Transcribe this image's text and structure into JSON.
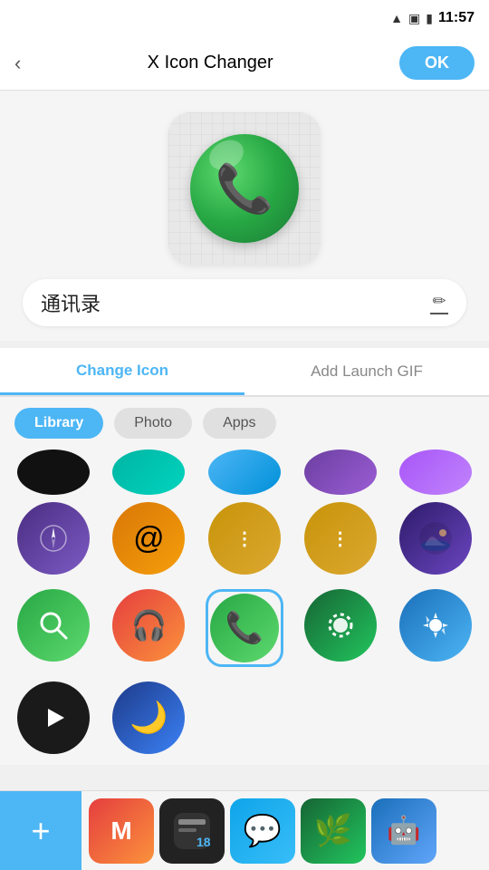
{
  "statusBar": {
    "time": "11:57",
    "wifiIcon": "▲",
    "simIcon": "▣",
    "batteryIcon": "🔋"
  },
  "topBar": {
    "backLabel": "‹",
    "title": "X Icon Changer",
    "okLabel": "OK"
  },
  "preview": {
    "appName": "通讯录",
    "editIconLabel": "✏"
  },
  "tabs": [
    {
      "id": "change-icon",
      "label": "Change Icon",
      "active": true
    },
    {
      "id": "add-launch-gif",
      "label": "Add Launch GIF",
      "active": false
    }
  ],
  "filters": [
    {
      "id": "library",
      "label": "Library",
      "selected": true
    },
    {
      "id": "photo",
      "label": "Photo",
      "selected": false
    },
    {
      "id": "apps",
      "label": "Apps",
      "selected": false
    }
  ],
  "partialRow": [
    {
      "id": "icon-black",
      "color": "black",
      "emoji": ""
    },
    {
      "id": "icon-teal",
      "color": "teal",
      "emoji": ""
    },
    {
      "id": "icon-blue",
      "color": "blue",
      "emoji": ""
    },
    {
      "id": "icon-purple-d",
      "color": "purple-dark",
      "emoji": ""
    },
    {
      "id": "icon-purple-l",
      "color": "purple-light",
      "emoji": ""
    }
  ],
  "gridRow2": [
    {
      "id": "r2-1",
      "colorClass": "i-purple-compass"
    },
    {
      "id": "r2-2",
      "colorClass": "i-orange-circle"
    },
    {
      "id": "r2-3",
      "colorClass": "i-gold-circle"
    },
    {
      "id": "r2-4",
      "colorClass": "i-gold2-circle"
    },
    {
      "id": "r2-5",
      "colorClass": "i-night-purple"
    }
  ],
  "gridRow3": [
    {
      "id": "r3-1",
      "colorClass": "i-green-circle"
    },
    {
      "id": "r3-2",
      "colorClass": "i-red-orange"
    },
    {
      "id": "r3-3",
      "colorClass": "i-green-circle",
      "selected": true
    },
    {
      "id": "r3-4",
      "colorClass": "i-green-dark"
    },
    {
      "id": "r3-5",
      "colorClass": "i-blue-gear"
    }
  ],
  "gridRow4": [
    {
      "id": "r4-1",
      "colorClass": "i-black-play"
    },
    {
      "id": "r4-2",
      "colorClass": "i-blue-moon"
    }
  ],
  "dock": {
    "addLabel": "+",
    "apps": [
      {
        "id": "dock-1",
        "colorClass": "i-red-orange"
      },
      {
        "id": "dock-2",
        "colorClass": ""
      },
      {
        "id": "dock-3",
        "colorClass": ""
      },
      {
        "id": "dock-4",
        "colorClass": "i-green-dark"
      },
      {
        "id": "dock-5",
        "colorClass": ""
      }
    ]
  }
}
